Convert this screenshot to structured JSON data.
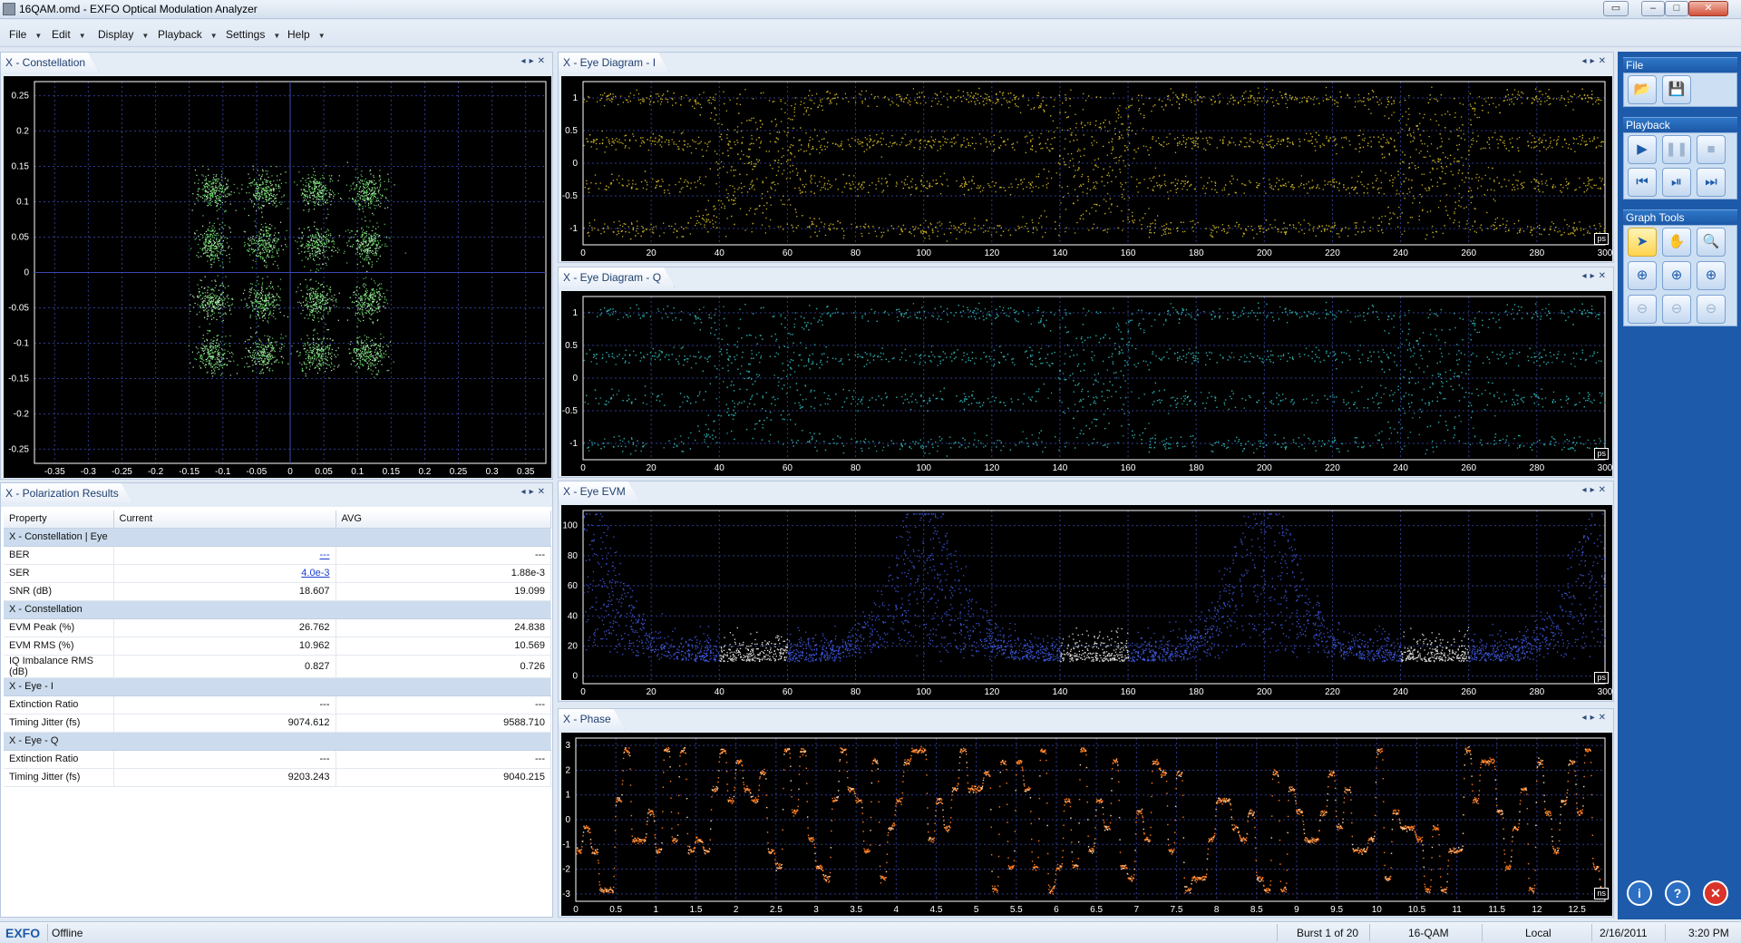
{
  "window": {
    "title": "16QAM.omd - EXFO Optical Modulation Analyzer"
  },
  "menu": [
    {
      "label": "File"
    },
    {
      "label": "Edit"
    },
    {
      "label": "Display"
    },
    {
      "label": "Playback"
    },
    {
      "label": "Settings"
    },
    {
      "label": "Help"
    }
  ],
  "panels": {
    "constellation": {
      "title": "X - Constellation"
    },
    "polarization": {
      "title": "X - Polarization Results"
    },
    "eye_i": {
      "title": "X - Eye Diagram - I"
    },
    "eye_q": {
      "title": "X - Eye Diagram - Q"
    },
    "eye_evm": {
      "title": "X - Eye EVM"
    },
    "phase": {
      "title": "X - Phase"
    }
  },
  "units": {
    "ps": "ps",
    "ns": "ns"
  },
  "results_table": {
    "headers": [
      "Property",
      "Current",
      "AVG"
    ],
    "rows": [
      {
        "type": "group",
        "label": "X - Constellation | Eye"
      },
      {
        "type": "row",
        "property": "BER",
        "current": "---",
        "avg": "---",
        "current_link": true
      },
      {
        "type": "row",
        "property": "SER",
        "current": "4.0e-3",
        "avg": "1.88e-3",
        "current_link": true
      },
      {
        "type": "row",
        "property": "SNR (dB)",
        "current": "18.607",
        "avg": "19.099"
      },
      {
        "type": "group",
        "label": "X - Constellation"
      },
      {
        "type": "row",
        "property": "EVM Peak (%)",
        "current": "26.762",
        "avg": "24.838"
      },
      {
        "type": "row",
        "property": "EVM RMS (%)",
        "current": "10.962",
        "avg": "10.569"
      },
      {
        "type": "row",
        "property": "IQ Imbalance RMS (dB)",
        "current": "0.827",
        "avg": "0.726"
      },
      {
        "type": "group",
        "label": "X - Eye - I"
      },
      {
        "type": "row",
        "property": "Extinction Ratio",
        "current": "---",
        "avg": "---"
      },
      {
        "type": "row",
        "property": "Timing Jitter (fs)",
        "current": "9074.612",
        "avg": "9588.710"
      },
      {
        "type": "group",
        "label": "X - Eye - Q"
      },
      {
        "type": "row",
        "property": "Extinction Ratio",
        "current": "---",
        "avg": "---"
      },
      {
        "type": "row",
        "property": "Timing Jitter (fs)",
        "current": "9203.243",
        "avg": "9040.215"
      }
    ]
  },
  "sidebar": {
    "file_title": "File",
    "playback_title": "Playback",
    "graph_tools_title": "Graph Tools",
    "icons": {
      "open": "folder-open-icon",
      "save": "save-icon",
      "play": "play-icon",
      "pause": "pause-icon",
      "stop": "stop-icon",
      "prev": "previous-icon",
      "step": "step-icon",
      "next": "next-icon",
      "select": "pointer-icon",
      "pan": "hand-icon",
      "zoom": "zoom-icon",
      "zoom_in_both": "zoom-in-both-icon",
      "zoom_in_x": "zoom-in-x-icon",
      "zoom_in_y": "zoom-in-y-icon",
      "zoom_out_both": "zoom-out-both-icon",
      "zoom_out_x": "zoom-out-x-icon",
      "zoom_out_y": "zoom-out-y-icon",
      "info": "info-icon",
      "help": "help-icon",
      "exit": "exit-icon"
    }
  },
  "status": {
    "brand": "EXFO",
    "connection": "Offline",
    "burst": "Burst 1 of 20",
    "modulation": "16-QAM",
    "mode": "Local",
    "date": "2/16/2011",
    "time": "3:20 PM"
  },
  "chart_data": [
    {
      "name": "X - Constellation",
      "type": "scatter",
      "x_ticks": [
        "-0.35",
        "-0.3",
        "-0.25",
        "-0.2",
        "-0.15",
        "-0.1",
        "-0.05",
        "0",
        "0.05",
        "0.1",
        "0.15",
        "0.2",
        "0.25",
        "0.3",
        "0.35"
      ],
      "y_ticks": [
        "0.25",
        "0.2",
        "0.15",
        "0.1",
        "0.05",
        "0",
        "-0.05",
        "-0.1",
        "-0.15",
        "-0.2",
        "-0.25"
      ],
      "xlim": [
        -0.38,
        0.38
      ],
      "ylim": [
        -0.27,
        0.27
      ],
      "cluster_centers_x": [
        -0.115,
        -0.04,
        0.04,
        0.115
      ],
      "cluster_centers_y": [
        0.115,
        0.04,
        -0.04,
        -0.115
      ],
      "color": "#5fd35f"
    },
    {
      "name": "X - Eye Diagram - I",
      "type": "scatter",
      "x_ticks": [
        "0",
        "20",
        "40",
        "60",
        "80",
        "100",
        "120",
        "140",
        "160",
        "180",
        "200",
        "220",
        "240",
        "260",
        "280",
        "300"
      ],
      "y_ticks": [
        "1",
        "0.5",
        "0",
        "-0.5",
        "-1"
      ],
      "xlim": [
        0,
        300
      ],
      "ylim": [
        -1.25,
        1.25
      ],
      "levels": [
        1,
        0.33,
        -0.33,
        -1
      ],
      "highlight_windows": [
        [
          40,
          60
        ],
        [
          140,
          160
        ],
        [
          240,
          260
        ]
      ],
      "color": "#c8b020",
      "highlight_color": "#dddddd"
    },
    {
      "name": "X - Eye Diagram - Q",
      "type": "scatter",
      "x_ticks": [
        "0",
        "20",
        "40",
        "60",
        "80",
        "100",
        "120",
        "140",
        "160",
        "180",
        "200",
        "220",
        "240",
        "260",
        "280",
        "300"
      ],
      "y_ticks": [
        "1",
        "0.5",
        "0",
        "-0.5",
        "-1"
      ],
      "xlim": [
        0,
        300
      ],
      "ylim": [
        -1.25,
        1.25
      ],
      "levels": [
        1,
        0.33,
        -0.33,
        -1
      ],
      "highlight_windows": [
        [
          40,
          60
        ],
        [
          140,
          160
        ],
        [
          240,
          260
        ]
      ],
      "color": "#2aa7a7",
      "highlight_color": "#dddddd"
    },
    {
      "name": "X - Eye EVM",
      "type": "scatter",
      "x_ticks": [
        "0",
        "20",
        "40",
        "60",
        "80",
        "100",
        "120",
        "140",
        "160",
        "180",
        "200",
        "220",
        "240",
        "260",
        "280",
        "300"
      ],
      "y_ticks": [
        "100",
        "80",
        "60",
        "40",
        "20",
        "0"
      ],
      "xlim": [
        0,
        300
      ],
      "ylim": [
        -5,
        110
      ],
      "highlight_windows": [
        [
          40,
          60
        ],
        [
          140,
          160
        ],
        [
          240,
          260
        ]
      ],
      "color": "#3c55d8",
      "highlight_color": "#dddddd"
    },
    {
      "name": "X - Phase",
      "type": "line",
      "x_ticks": [
        "0",
        "0.5",
        "1",
        "1.5",
        "2",
        "2.5",
        "3",
        "3.5",
        "4",
        "4.5",
        "5",
        "5.5",
        "6",
        "6.5",
        "7",
        "7.5",
        "8",
        "8.5",
        "9",
        "9.5",
        "10",
        "10.5",
        "11",
        "11.5",
        "12",
        "12.5"
      ],
      "y_ticks": [
        "3",
        "2",
        "1",
        "0",
        "-1",
        "-2",
        "-3"
      ],
      "xlim": [
        0,
        12.85
      ],
      "ylim": [
        -3.3,
        3.3
      ],
      "color": "#ff7a1a"
    }
  ]
}
